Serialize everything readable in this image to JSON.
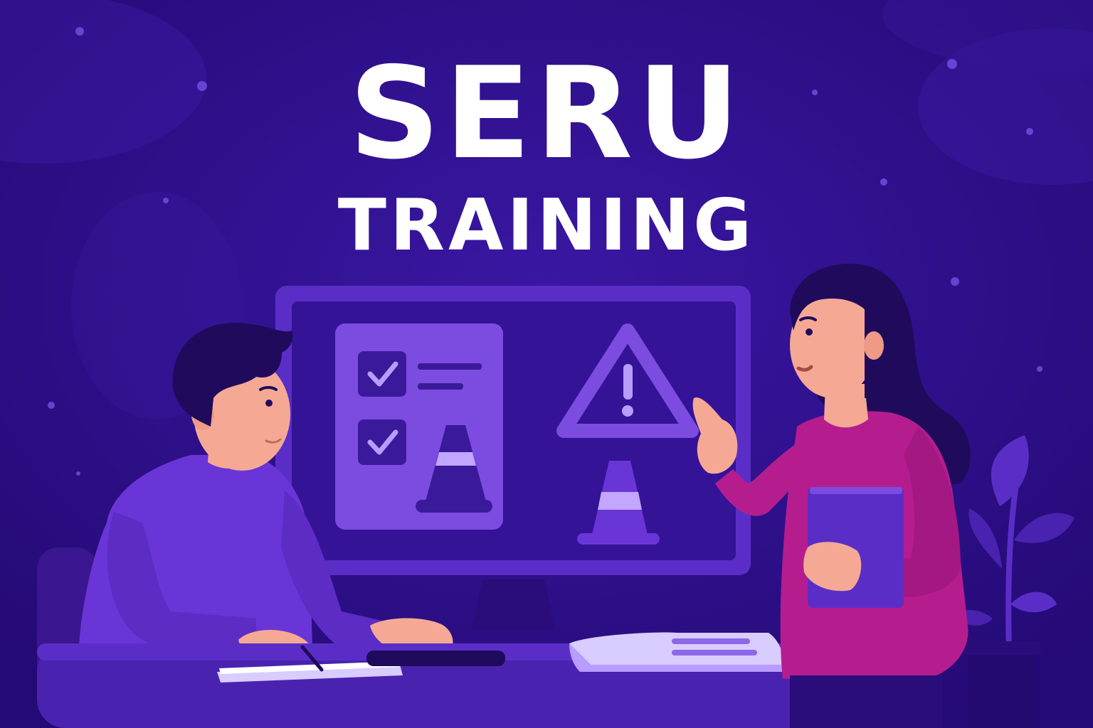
{
  "title": {
    "main": "SERU",
    "sub": "TRAINING"
  },
  "colors": {
    "background": "#2b0f86",
    "monitor_frame": "#5a2ec6",
    "screen": "#341397",
    "panel": "#7c4be0",
    "accent_light": "#b89cff",
    "man_shirt": "#6a35d6",
    "woman_shirt": "#b51d8f",
    "skin": "#f5a995",
    "hair": "#200a5c",
    "text": "#ffffff"
  },
  "icons": [
    "checkbox-checked-icon",
    "warning-triangle-icon",
    "traffic-cone-icon",
    "plant-icon"
  ]
}
